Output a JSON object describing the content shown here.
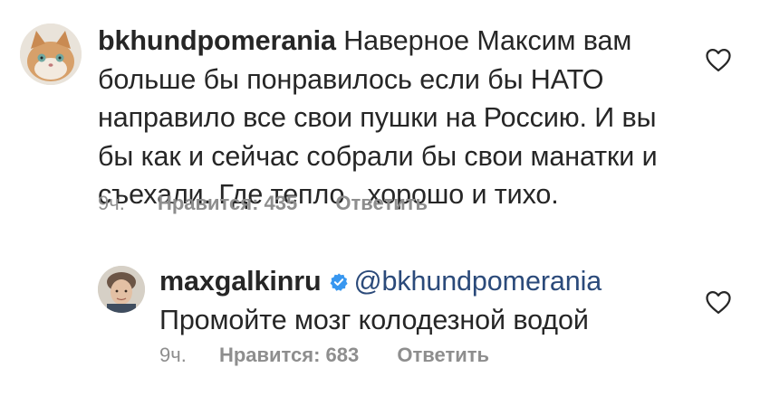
{
  "comments": [
    {
      "username": "bkhundpomerania",
      "lines": [
        "Наверное Максим вам",
        "больше бы понравилось если бы НАТО",
        "направило все свои пушки на Россию.  И вы",
        "бы как и сейчас собрали бы свои манатки и",
        "съехали.  Где тепло , хорошо и тихо."
      ],
      "time": "9ч.",
      "likes": "Нравится: 435",
      "reply": "Ответить",
      "avatar_icon": "cat-avatar-icon",
      "like_icon": "heart-outline-icon"
    },
    {
      "username": "maxgalkinru",
      "verified": true,
      "mention": "@bkhundpomerania",
      "lines": [
        "Промойте мозг колодезной водой"
      ],
      "time": "9ч.",
      "likes": "Нравится: 683",
      "reply": "Ответить",
      "avatar_icon": "person-avatar-icon",
      "like_icon": "heart-outline-icon"
    }
  ],
  "colors": {
    "text": "#262626",
    "meta": "#8e8e8e",
    "mention": "#2b4a7a",
    "verified": "#3897f0"
  }
}
